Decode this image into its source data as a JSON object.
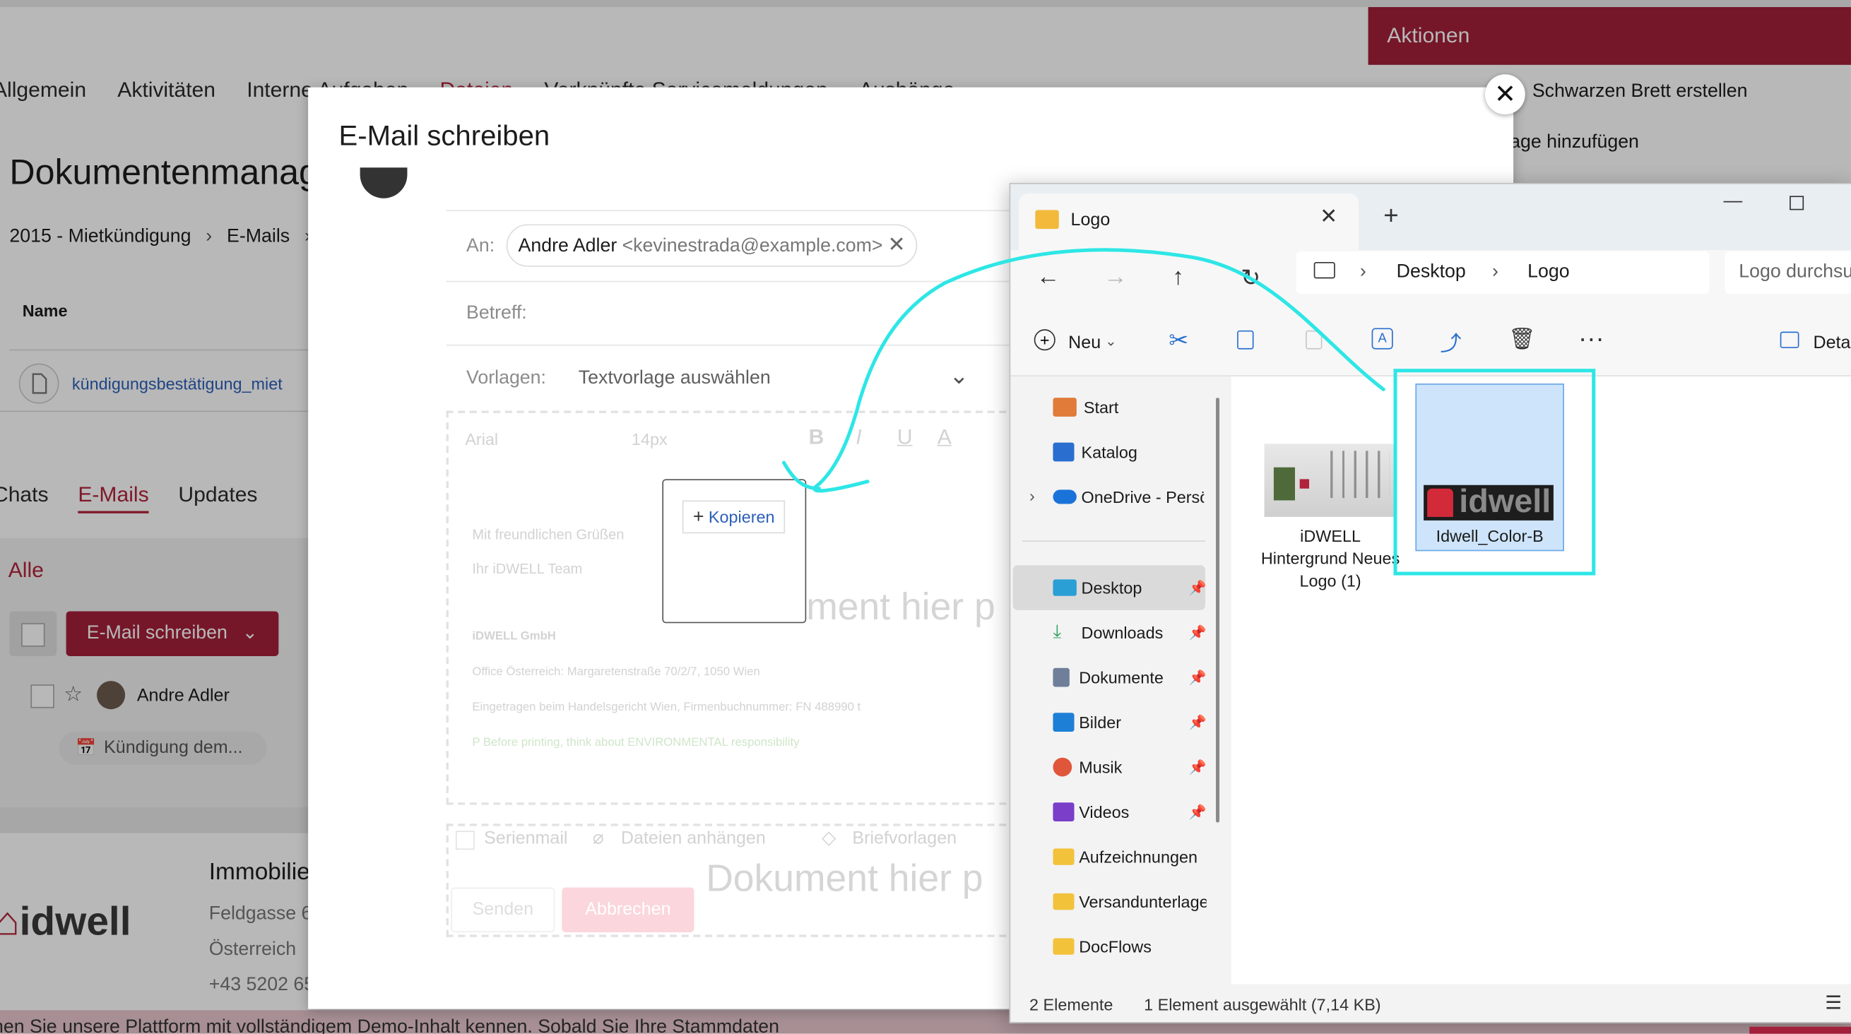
{
  "background_app": {
    "tabs": [
      "Allgemein",
      "Aktivitäten",
      "Interne Aufgaben",
      "Dateien",
      "Verknüpfte Servicemeldungen",
      "Aushänge"
    ],
    "page_title": "Dokumentenmanagement",
    "breadcrumb": [
      "2015 - Mietkündigung",
      "E-Mails"
    ],
    "column_header": "Name",
    "file_name": "kündigungsbestätigung_miet",
    "sub_tabs": [
      "Chats",
      "E-Mails",
      "Updates"
    ],
    "filter_label": "Alle",
    "compose_button": "E-Mail schreiben",
    "contact_name": "Andre Adler",
    "email_subject_chip": "Kündigung dem...",
    "company_heading": "Immobilien",
    "address_lines": [
      "Feldgasse 6",
      "Österreich",
      "+43 5202 65"
    ],
    "bottom_banner": "nen Sie unsere Plattform mit vollständigem Demo-Inhalt kennen. Sobald Sie Ihre Stammdaten",
    "actions_title": "Aktionen",
    "actions": [
      "Schwarzen Brett erstellen",
      "age hinzufügen"
    ]
  },
  "modal": {
    "title": "E-Mail schreiben",
    "to_label": "An:",
    "recipient_name": "Andre Adler",
    "recipient_email": "<kevinestrada@example.com>",
    "subject_label": "Betreff:",
    "templates_label": "Vorlagen:",
    "templates_value": "Textvorlage auswählen",
    "font_family": "Arial",
    "font_size": "14px",
    "signature_lines": [
      "Mit freundlichen Grüßen",
      "Ihr iDWELL Team",
      "iDWELL GmbH",
      "Office Österreich: Margaretenstraße 70/2/7, 1050 Wien",
      "Eingetragen beim Handelsgericht Wien, Firmenbuchnummer: FN 488990 t",
      "P Before printing, think about ENVIRONMENTAL responsibility"
    ],
    "drop_hint": "ment hier p",
    "drop_hint_lower": "Dokument hier p",
    "copy_label": "Kopieren",
    "options": [
      "Serienmail",
      "Dateien anhängen",
      "Briefvorlagen"
    ],
    "send_label": "Senden",
    "cancel_label": "Abbrechen"
  },
  "explorer": {
    "tab_title": "Logo",
    "path": [
      "Desktop",
      "Logo"
    ],
    "search_placeholder": "Logo durchsuchen",
    "new_label": "Neu",
    "details_label": "Details",
    "nav_items": [
      {
        "label": "Start",
        "icon": "home-icon"
      },
      {
        "label": "Katalog",
        "icon": "gallery-icon"
      },
      {
        "label": "OneDrive - Persönlich",
        "icon": "cloud-icon"
      },
      {
        "label": "Desktop",
        "icon": "desktop-icon"
      },
      {
        "label": "Downloads",
        "icon": "download-icon"
      },
      {
        "label": "Dokumente",
        "icon": "document-icon"
      },
      {
        "label": "Bilder",
        "icon": "image-icon"
      },
      {
        "label": "Musik",
        "icon": "music-icon"
      },
      {
        "label": "Videos",
        "icon": "video-icon"
      },
      {
        "label": "Aufzeichnungen",
        "icon": "folder-icon"
      },
      {
        "label": "Versandunterlagen",
        "icon": "folder-icon"
      },
      {
        "label": "DocFlows",
        "icon": "folder-icon"
      }
    ],
    "files": [
      {
        "name": "iDWELL Hintergrund Neues Logo (1)",
        "selected": false
      },
      {
        "name": "Idwell_Color-B",
        "selected": true
      }
    ],
    "logo_text": "idwell",
    "status_count": "2 Elemente",
    "status_selection": "1 Element ausgewählt (7,14 KB)"
  },
  "colors": {
    "brand_red": "#a3203a",
    "highlight": "#2ee6e6",
    "link_blue": "#2b5fb8"
  }
}
